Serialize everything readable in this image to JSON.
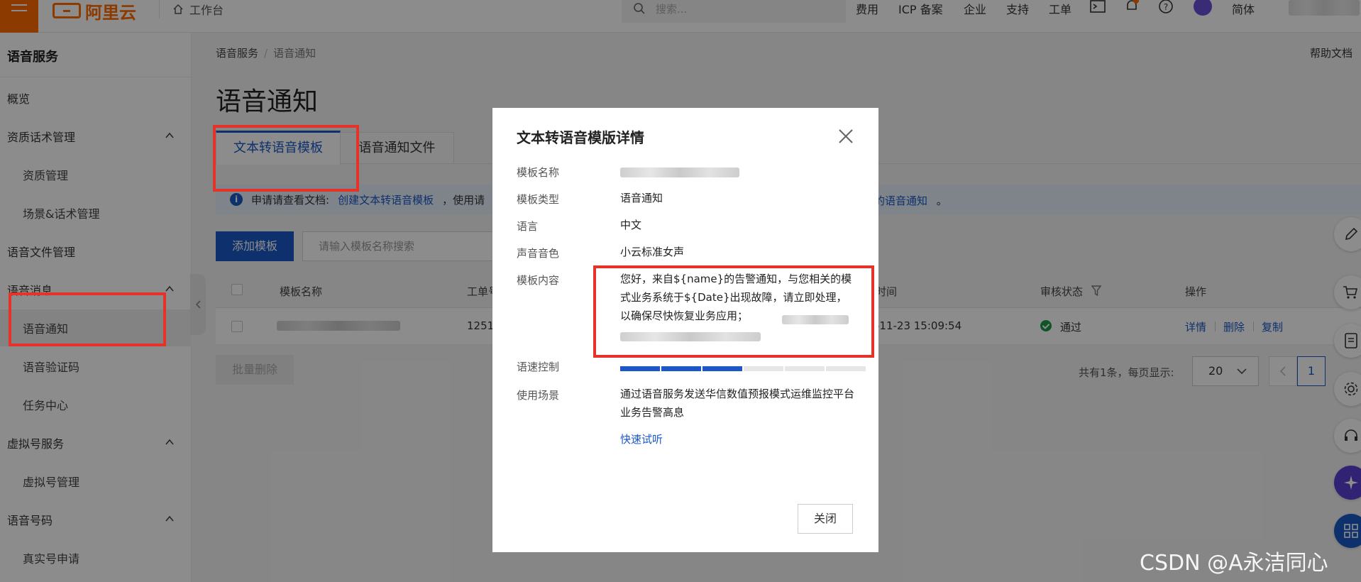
{
  "topbar": {
    "logo_text": "阿里云",
    "workbench_label": "工作台",
    "search_placeholder": "搜索...",
    "nav": [
      "费用",
      "ICP 备案",
      "企业",
      "支持",
      "工单"
    ],
    "language_label": "简体"
  },
  "sidebar": {
    "title": "语音服务",
    "items": [
      {
        "label": "概览"
      },
      {
        "label": "资质话术管理"
      },
      {
        "label": "资质管理"
      },
      {
        "label": "场景&话术管理"
      },
      {
        "label": "语音文件管理"
      },
      {
        "label": "语音消息"
      },
      {
        "label": "语音通知"
      },
      {
        "label": "语音验证码"
      },
      {
        "label": "任务中心"
      },
      {
        "label": "虚拟号服务"
      },
      {
        "label": "虚拟号管理"
      },
      {
        "label": "语音号码"
      },
      {
        "label": "真实号申请"
      }
    ]
  },
  "breadcrumb": {
    "root": "语音服务",
    "separator": "/",
    "current": "语音通知"
  },
  "help_label": "帮助文档",
  "page_title": "语音通知",
  "tabs": [
    {
      "label": "文本转语音模板"
    },
    {
      "label": "语音通知文件"
    }
  ],
  "notice": {
    "prefix": "申请请查看文档:",
    "link": "创建文本转语音模板",
    "middle": "，使用请",
    "tail_link": "的语音通知",
    "tail_end": "。"
  },
  "toolbar": {
    "add_button": "添加模板",
    "search_placeholder": "请输入模板名称搜索",
    "batch_delete": "批量删除"
  },
  "table": {
    "columns": [
      "模板名称",
      "工单号",
      "时间",
      "审核状态",
      "操作"
    ],
    "rows": [
      {
        "code": "12514",
        "time": "-11-23 15:09:54",
        "status": "通过",
        "actions": [
          "详情",
          "删除",
          "复制"
        ]
      }
    ]
  },
  "pagination": {
    "summary": "共有1条，每页显示:",
    "page_size": "20",
    "current_page": "1"
  },
  "modal": {
    "title": "文本转语音模版详情",
    "fields": {
      "name_label": "模板名称",
      "type_label": "模板类型",
      "type_value": "语音通知",
      "lang_label": "语言",
      "lang_value": "中文",
      "voice_label": "声音音色",
      "voice_value": "小云标准女声",
      "content_label": "模板内容",
      "content_value": "您好，来自${name}的告警通知，与您相关的模式业务系统于${Date}出现故障，请立即处理，以确保尽快恢复业务应用；",
      "speed_label": "语速控制",
      "scene_label": "使用场景",
      "scene_value": "通过语音服务发送华信数值预报模式运维监控平台业务告警高息"
    },
    "speed_level": 3,
    "speed_max": 6,
    "try_link": "快速试听",
    "close_button": "关闭"
  },
  "watermark": "CSDN @A永洁同心",
  "colors": {
    "accent": "#1b58c6",
    "brand": "#ff6a00",
    "annotation": "#e5332a",
    "success": "#1a9a47"
  }
}
